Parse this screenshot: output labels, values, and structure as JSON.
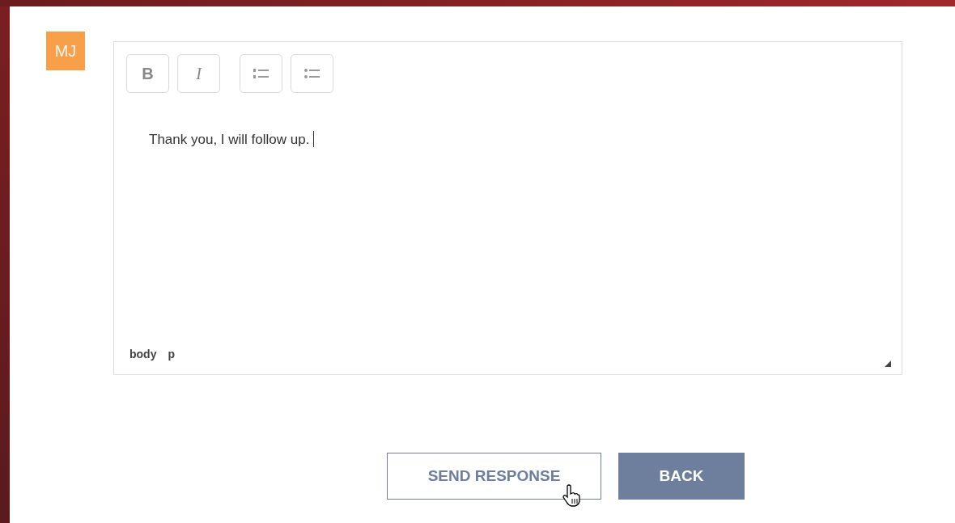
{
  "avatar": {
    "initials": "MJ"
  },
  "editor": {
    "toolbar": [
      {
        "kind": "bold",
        "label": "B"
      },
      {
        "kind": "italic",
        "label": "I"
      },
      {
        "kind": "ordered-list"
      },
      {
        "kind": "bullet-list"
      }
    ],
    "value": "Thank you, I will follow up.",
    "path": [
      "body",
      "p"
    ]
  },
  "buttons": [
    {
      "kind": "outline",
      "label": "SEND RESPONSE"
    },
    {
      "kind": "filled",
      "label": "BACK"
    }
  ]
}
